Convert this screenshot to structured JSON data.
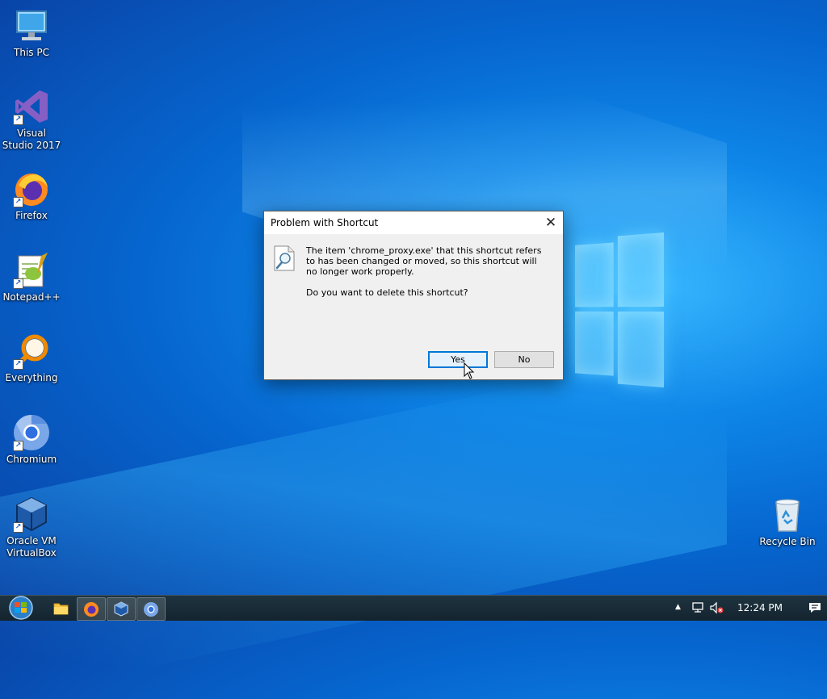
{
  "desktop": {
    "icons": [
      {
        "label": "This PC"
      },
      {
        "label": "Visual Studio 2017"
      },
      {
        "label": "Firefox"
      },
      {
        "label": "Notepad++"
      },
      {
        "label": "Everything"
      },
      {
        "label": "Chromium"
      },
      {
        "label": "Oracle VM VirtualBox"
      },
      {
        "label": "Recycle Bin"
      }
    ]
  },
  "dialog": {
    "title": "Problem with Shortcut",
    "close_symbol": "✕",
    "message": "The item 'chrome_proxy.exe' that this shortcut refers to has been changed or moved, so this shortcut will no longer work properly.",
    "question": "Do you want to delete this shortcut?",
    "yes_label": "Yes",
    "no_label": "No",
    "icon": "document-magnifier-icon"
  },
  "taskbar": {
    "start_icon": "windows-start-orb-icon",
    "pinned": [
      {
        "name": "file-explorer-icon"
      },
      {
        "name": "firefox-icon"
      },
      {
        "name": "virtualbox-icon"
      },
      {
        "name": "chromium-icon"
      }
    ],
    "tray": {
      "show_hidden_symbol": "▲",
      "clock": "12:24 PM"
    }
  },
  "colors": {
    "accent": "#0078d7",
    "desktop_blue": "#0a6fd8",
    "taskbar": "#1a2c38"
  }
}
